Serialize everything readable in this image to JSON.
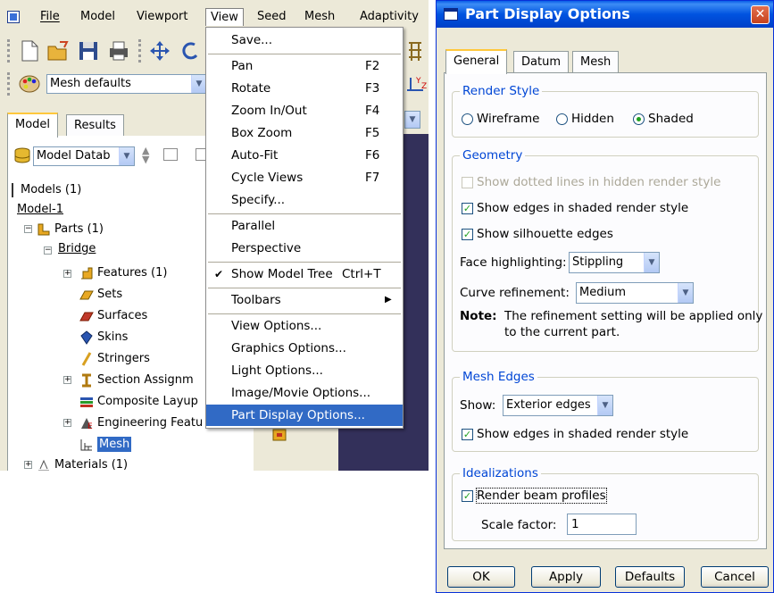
{
  "menubar": {
    "items": [
      "File",
      "Model",
      "Viewport",
      "View",
      "Seed",
      "Mesh",
      "Adaptivity"
    ]
  },
  "toolbar": {
    "module_combo": "Mesh defaults"
  },
  "panel": {
    "tabs": [
      "Model",
      "Results"
    ],
    "db_combo": "Model Datab"
  },
  "tree": {
    "rows": [
      "Models (1)",
      "Model-1",
      "Parts (1)",
      "Bridge",
      "Features (1)",
      "Sets",
      "Surfaces",
      "Skins",
      "Stringers",
      "Section Assignm",
      "Composite Layup",
      "Engineering Featu",
      "Mesh",
      "Materials (1)"
    ]
  },
  "view_menu": {
    "items": [
      {
        "label": "Save...",
        "shortcut": ""
      },
      {
        "label": "Pan",
        "shortcut": "F2"
      },
      {
        "label": "Rotate",
        "shortcut": "F3"
      },
      {
        "label": "Zoom In/Out",
        "shortcut": "F4"
      },
      {
        "label": "Box Zoom",
        "shortcut": "F5"
      },
      {
        "label": "Auto-Fit",
        "shortcut": "F6"
      },
      {
        "label": "Cycle Views",
        "shortcut": "F7"
      },
      {
        "label": "Specify...",
        "shortcut": ""
      },
      {
        "label": "Parallel",
        "shortcut": ""
      },
      {
        "label": "Perspective",
        "shortcut": ""
      },
      {
        "label": "Show Model Tree",
        "shortcut": "Ctrl+T"
      },
      {
        "label": "Toolbars",
        "shortcut": ""
      },
      {
        "label": "View Options...",
        "shortcut": ""
      },
      {
        "label": "Graphics Options...",
        "shortcut": ""
      },
      {
        "label": "Light Options...",
        "shortcut": ""
      },
      {
        "label": "Image/Movie Options...",
        "shortcut": ""
      },
      {
        "label": "Part Display Options...",
        "shortcut": ""
      }
    ]
  },
  "dialog": {
    "title": "Part Display Options",
    "tabs": [
      "General",
      "Datum",
      "Mesh"
    ],
    "render_style": {
      "title": "Render Style",
      "options": [
        "Wireframe",
        "Hidden",
        "Shaded"
      ],
      "selected": "Shaded"
    },
    "geometry": {
      "title": "Geometry",
      "dotted_lines": "Show dotted lines in hidden render style",
      "show_edges": "Show edges in shaded render style",
      "silhouette": "Show silhouette edges",
      "face_label": "Face highlighting:",
      "face_value": "Stippling",
      "curve_label": "Curve refinement:",
      "curve_value": "Medium",
      "note_label": "Note:",
      "note_line1": "The refinement setting will be applied only",
      "note_line2": "to the current part."
    },
    "mesh_edges": {
      "title": "Mesh Edges",
      "show_label": "Show:",
      "show_value": "Exterior edges",
      "show_edges": "Show edges in shaded render style"
    },
    "idealizations": {
      "title": "Idealizations",
      "beam_profiles": "Render beam profiles",
      "scale_label": "Scale factor:",
      "scale_value": "1"
    },
    "buttons": {
      "ok": "OK",
      "apply": "Apply",
      "defaults": "Defaults",
      "cancel": "Cancel"
    }
  },
  "colors": {
    "accent": "#316ac5",
    "title_bar": "#0053e0",
    "group_title": "#0046d5"
  }
}
